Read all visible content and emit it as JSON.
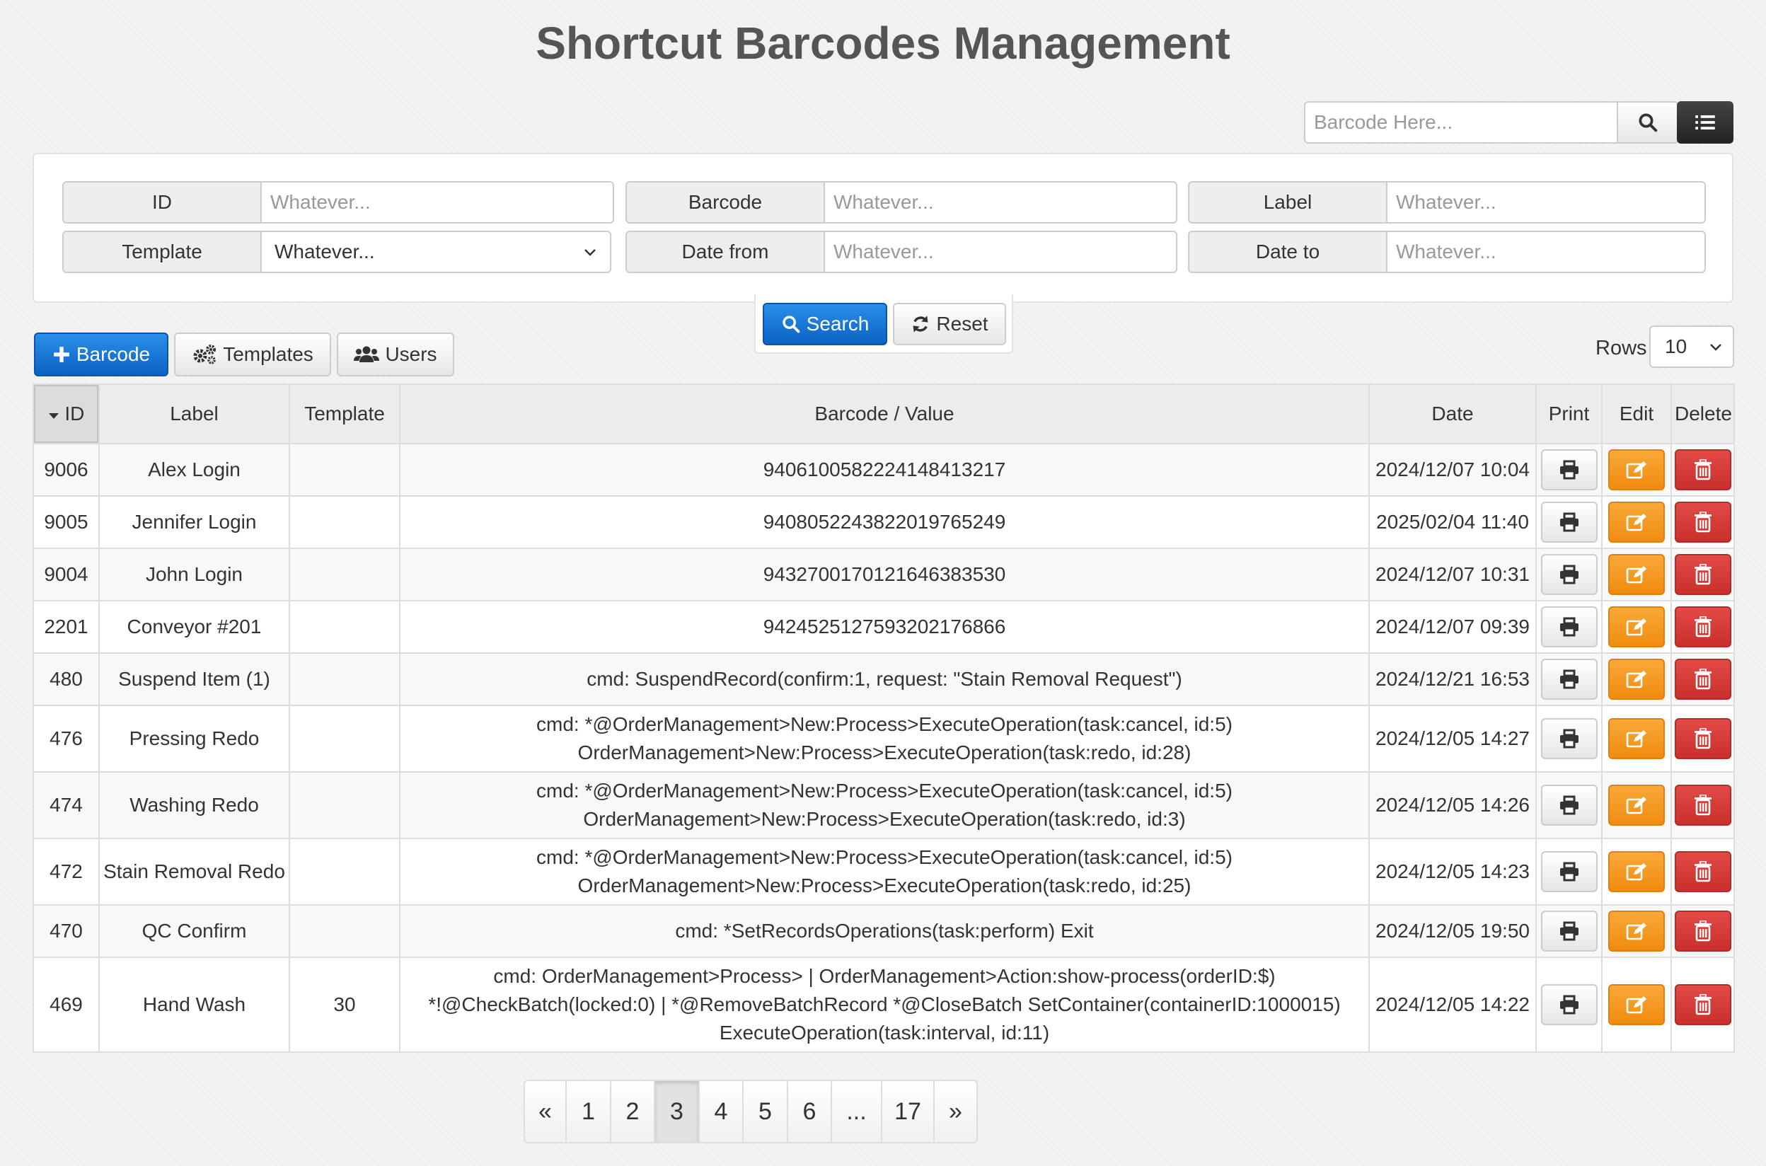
{
  "title": "Shortcut Barcodes Management",
  "top_search": {
    "placeholder": "Barcode Here..."
  },
  "filters": {
    "id": {
      "label": "ID",
      "placeholder": "Whatever..."
    },
    "barcode": {
      "label": "Barcode",
      "placeholder": "Whatever..."
    },
    "label": {
      "label": "Label",
      "placeholder": "Whatever..."
    },
    "template": {
      "label": "Template",
      "value": "Whatever..."
    },
    "date_from": {
      "label": "Date from",
      "placeholder": "Whatever..."
    },
    "date_to": {
      "label": "Date to",
      "placeholder": "Whatever..."
    }
  },
  "actions": {
    "search": "Search",
    "reset": "Reset"
  },
  "toolbar": {
    "barcode": "Barcode",
    "templates": "Templates",
    "users": "Users"
  },
  "rows_select": {
    "label": "Rows",
    "value": "10"
  },
  "table": {
    "headers": {
      "id": "ID",
      "label": "Label",
      "template": "Template",
      "barcode": "Barcode / Value",
      "date": "Date",
      "print": "Print",
      "edit": "Edit",
      "delete": "Delete"
    },
    "rows": [
      {
        "id": "9006",
        "label": "Alex Login",
        "template": "",
        "value": [
          "9406100582224148413217"
        ],
        "date": "2024/12/07 10:04"
      },
      {
        "id": "9005",
        "label": "Jennifer Login",
        "template": "",
        "value": [
          "9408052243822019765249"
        ],
        "date": "2025/02/04 11:40"
      },
      {
        "id": "9004",
        "label": "John Login",
        "template": "",
        "value": [
          "9432700170121646383530"
        ],
        "date": "2024/12/07 10:31"
      },
      {
        "id": "2201",
        "label": "Conveyor #201",
        "template": "",
        "value": [
          "9424525127593202176866"
        ],
        "date": "2024/12/07 09:39"
      },
      {
        "id": "480",
        "label": "Suspend Item (1)",
        "template": "",
        "value": [
          "cmd: SuspendRecord(confirm:1, request: \"Stain Removal Request\")"
        ],
        "date": "2024/12/21 16:53"
      },
      {
        "id": "476",
        "label": "Pressing Redo",
        "template": "",
        "value": [
          "cmd: *@OrderManagement>New:Process>ExecuteOperation(task:cancel, id:5)",
          "OrderManagement>New:Process>ExecuteOperation(task:redo, id:28)"
        ],
        "date": "2024/12/05 14:27"
      },
      {
        "id": "474",
        "label": "Washing Redo",
        "template": "",
        "value": [
          "cmd: *@OrderManagement>New:Process>ExecuteOperation(task:cancel, id:5)",
          "OrderManagement>New:Process>ExecuteOperation(task:redo, id:3)"
        ],
        "date": "2024/12/05 14:26"
      },
      {
        "id": "472",
        "label": "Stain Removal Redo",
        "template": "",
        "value": [
          "cmd: *@OrderManagement>New:Process>ExecuteOperation(task:cancel, id:5)",
          "OrderManagement>New:Process>ExecuteOperation(task:redo, id:25)"
        ],
        "date": "2024/12/05 14:23"
      },
      {
        "id": "470",
        "label": "QC Confirm",
        "template": "",
        "value": [
          "cmd: *SetRecordsOperations(task:perform) Exit"
        ],
        "date": "2024/12/05 19:50"
      },
      {
        "id": "469",
        "label": "Hand Wash",
        "template": "30",
        "value": [
          "cmd: OrderManagement>Process> | OrderManagement>Action:show-process(orderID:$)",
          "*!@CheckBatch(locked:0) | *@RemoveBatchRecord *@CloseBatch SetContainer(containerID:1000015)",
          "ExecuteOperation(task:interval, id:11)"
        ],
        "date": "2024/12/05 14:22"
      }
    ]
  },
  "pagination": {
    "prev": "«",
    "pages": [
      "1",
      "2",
      "3",
      "4",
      "5",
      "6",
      "...",
      "17"
    ],
    "active": "3",
    "next": "»"
  },
  "icons": {
    "search": "search-icon",
    "list": "list-icon",
    "plus": "plus-icon",
    "gears": "gears-icon",
    "users": "users-icon",
    "refresh": "refresh-icon",
    "caret": "caret-down-icon",
    "print": "print-icon",
    "edit": "edit-icon",
    "trash": "trash-icon"
  },
  "colors": {
    "primary": "#0b62c4",
    "warning": "#f08c0e",
    "danger": "#c9302c",
    "dark": "#222222"
  }
}
